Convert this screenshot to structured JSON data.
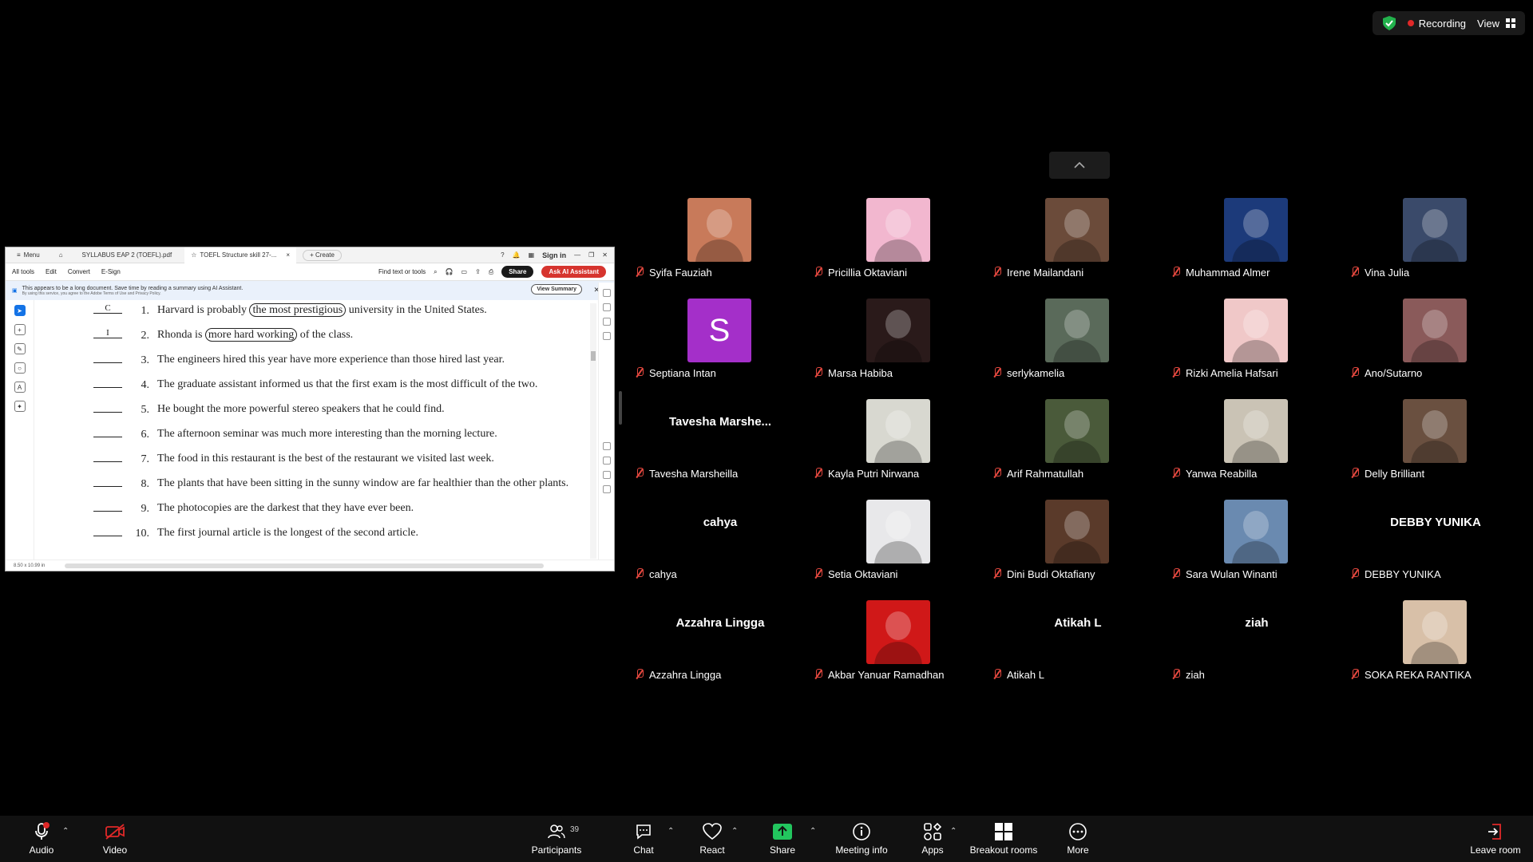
{
  "status": {
    "recording_label": "Recording",
    "view_label": "View"
  },
  "document": {
    "tabs": [
      "Menu",
      "SYLLABUS EAP 2 (TOEFL).pdf",
      "TOEFL Structure skill 27-...",
      "+ Create"
    ],
    "sign_in": "Sign in",
    "toolbar": [
      "All tools",
      "Edit",
      "Convert",
      "E-Sign"
    ],
    "find_placeholder": "Find text or tools",
    "share_btn": "Share",
    "ai_btn": "Ask AI Assistant",
    "banner_text": "This appears to be a long document. Save time by reading a summary using AI Assistant.",
    "banner_sub": "By using this service, you agree to the Adobe Terms of Use and Privacy Policy.",
    "view_summary": "View Summary",
    "page_size": "8.50 x 10.99 in",
    "questions": [
      {
        "answer": "C",
        "num": "1.",
        "pre": "Harvard is probably ",
        "circled": "the most prestigious",
        "post": " university in the United States."
      },
      {
        "answer": "I",
        "num": "2.",
        "pre": "Rhonda is ",
        "circled": "more hard working",
        "post": " of the class."
      },
      {
        "answer": "",
        "num": "3.",
        "pre": "The engineers hired this year have more experience than those hired last year.",
        "circled": "",
        "post": ""
      },
      {
        "answer": "",
        "num": "4.",
        "pre": "The graduate assistant informed us that the first exam is the most difficult of the two.",
        "circled": "",
        "post": ""
      },
      {
        "answer": "",
        "num": "5.",
        "pre": "He bought the more powerful stereo speakers that he could find.",
        "circled": "",
        "post": ""
      },
      {
        "answer": "",
        "num": "6.",
        "pre": "The afternoon seminar was much more interesting than the morning lecture.",
        "circled": "",
        "post": ""
      },
      {
        "answer": "",
        "num": "7.",
        "pre": "The food in this restaurant is the best of the restaurant we visited last week.",
        "circled": "",
        "post": ""
      },
      {
        "answer": "",
        "num": "8.",
        "pre": "The plants that have been sitting in the sunny window are far healthier than the other plants.",
        "circled": "",
        "post": ""
      },
      {
        "answer": "",
        "num": "9.",
        "pre": "The photocopies are the darkest that they have ever been.",
        "circled": "",
        "post": ""
      },
      {
        "answer": "",
        "num": "10.",
        "pre": "The first journal article is the longest of the second article.",
        "circled": "",
        "post": ""
      }
    ]
  },
  "participants": [
    {
      "name": "Syifa Fauziah",
      "tile": "Syifa Fauziah",
      "kind": "photo",
      "color": "#c87a5a"
    },
    {
      "name": "Pricillia Oktaviani",
      "tile": "Pricillia Oktaviani",
      "kind": "photo",
      "color": "#f2b7cf"
    },
    {
      "name": "Irene Mailandani",
      "tile": "Irene Mailandani",
      "kind": "photo",
      "color": "#6b4b3a"
    },
    {
      "name": "Muhammad Almer",
      "tile": "Muhammad Almer",
      "kind": "photo",
      "color": "#1c3a7a"
    },
    {
      "name": "Vina Julia",
      "tile": "Vina Julia",
      "kind": "photo",
      "color": "#3a4a6a"
    },
    {
      "name": "Septiana Intan",
      "tile": "S",
      "kind": "initial",
      "color": "#a42fc9"
    },
    {
      "name": "Marsa Habiba",
      "tile": "Marsa Habiba",
      "kind": "photo",
      "color": "#2a1a1a"
    },
    {
      "name": "serlykamelia",
      "tile": "serlykamelia",
      "kind": "photo",
      "color": "#5a6a5a"
    },
    {
      "name": "Rizki Amelia Hafsari",
      "tile": "Rizki Amelia Hafsari",
      "kind": "photo",
      "color": "#f0c8c8"
    },
    {
      "name": "Ano/Sutarno",
      "tile": "Ano/Sutarno",
      "kind": "photo",
      "color": "#8a5a5a"
    },
    {
      "name": "Tavesha Marsheilla",
      "tile": "Tavesha  Marshe...",
      "kind": "text",
      "color": ""
    },
    {
      "name": "Kayla Putri Nirwana",
      "tile": "Kayla Putri Nirwana",
      "kind": "photo",
      "color": "#d8d8d0"
    },
    {
      "name": "Arif Rahmatullah",
      "tile": "Arif Rahmatullah",
      "kind": "photo",
      "color": "#4a5a3a"
    },
    {
      "name": "Yanwa Reabilla",
      "tile": "Yanwa Reabilla",
      "kind": "photo",
      "color": "#cac3b5"
    },
    {
      "name": "Delly Brilliant",
      "tile": "Delly Brilliant",
      "kind": "photo",
      "color": "#6a5040"
    },
    {
      "name": "cahya",
      "tile": "cahya",
      "kind": "text",
      "color": ""
    },
    {
      "name": "Setia Oktaviani",
      "tile": "Setia Oktaviani",
      "kind": "photo",
      "color": "#e8e8ea"
    },
    {
      "name": "Dini Budi Oktafiany",
      "tile": "Dini Budi Oktafiany",
      "kind": "photo",
      "color": "#5a3a2a"
    },
    {
      "name": "Sara Wulan Winanti",
      "tile": "Sara Wulan Winanti",
      "kind": "photo",
      "color": "#6a8ab0"
    },
    {
      "name": "DEBBY YUNIKA",
      "tile": "DEBBY YUNIKA",
      "kind": "text",
      "color": ""
    },
    {
      "name": "Azzahra Lingga",
      "tile": "Azzahra Lingga",
      "kind": "text",
      "color": ""
    },
    {
      "name": "Akbar Yanuar Ramadhan",
      "tile": "Akbar Yanuar Ramadhan",
      "kind": "photo",
      "color": "#d01818"
    },
    {
      "name": "Atikah L",
      "tile": "Atikah L",
      "kind": "text",
      "color": ""
    },
    {
      "name": "ziah",
      "tile": "ziah",
      "kind": "text",
      "color": ""
    },
    {
      "name": "SOKA REKA RANTIKA",
      "tile": "SOKA REKA RANTIKA",
      "kind": "photo",
      "color": "#d8c0a8"
    }
  ],
  "bottom": {
    "audio": "Audio",
    "video": "Video",
    "participants": "Participants",
    "participants_count": "39",
    "chat": "Chat",
    "react": "React",
    "share": "Share",
    "meeting_info": "Meeting info",
    "apps": "Apps",
    "breakout": "Breakout rooms",
    "more": "More",
    "leave": "Leave room"
  }
}
